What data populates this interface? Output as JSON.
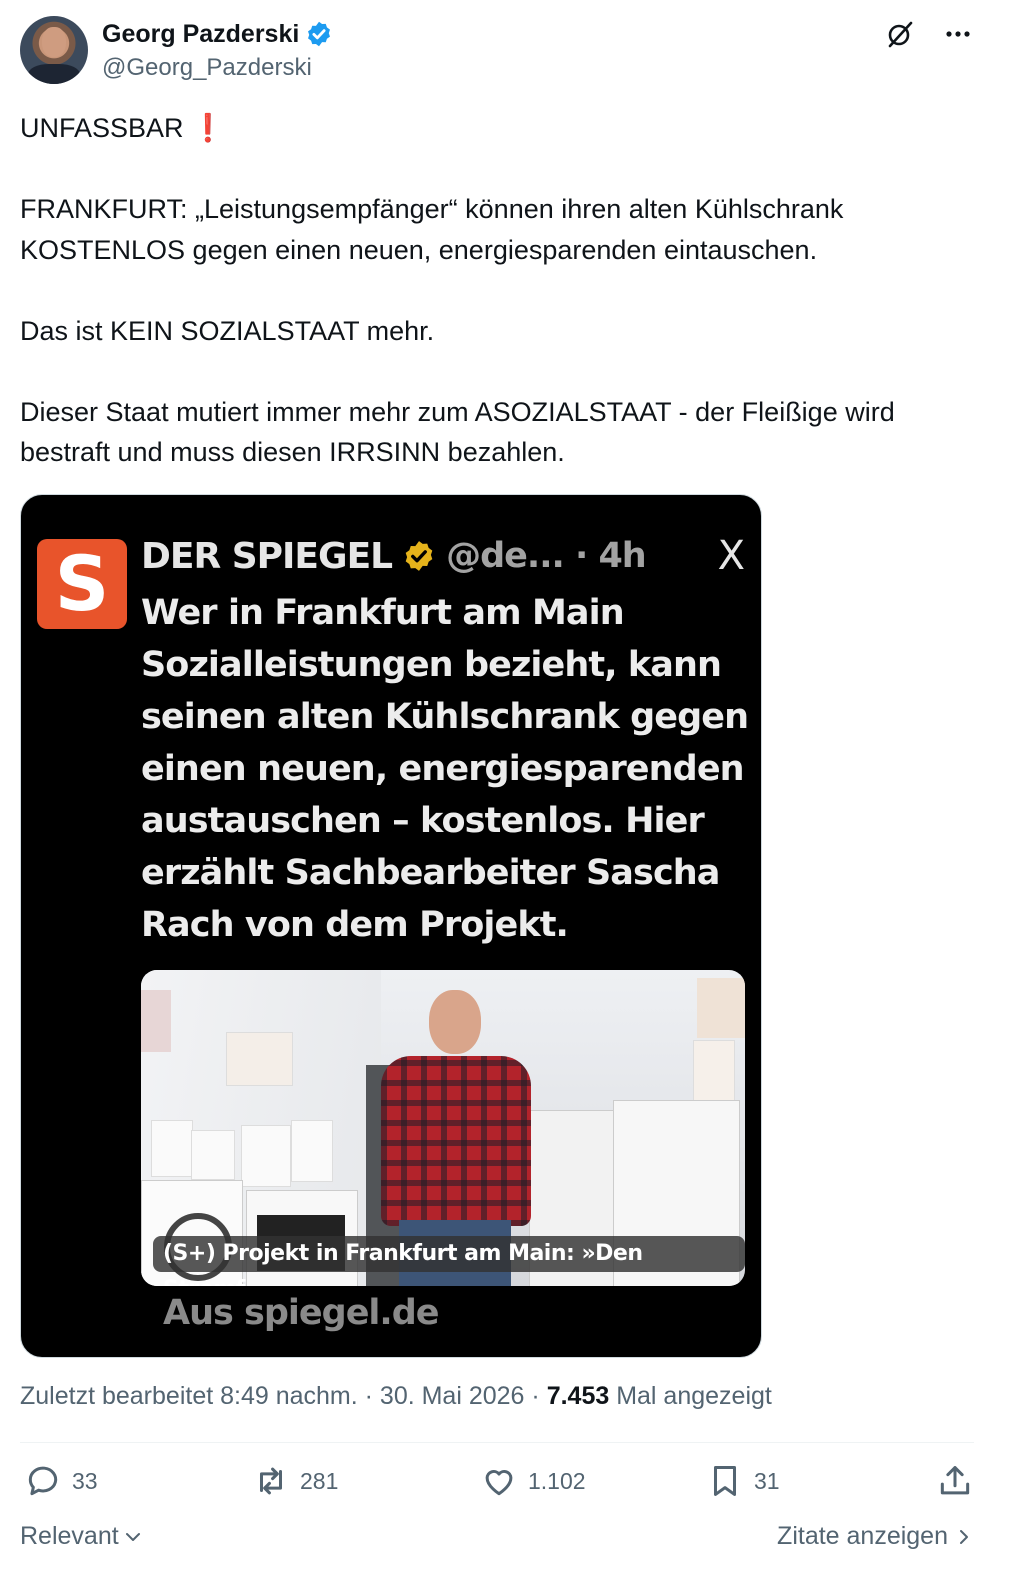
{
  "author": {
    "name": "Georg Pazderski",
    "handle": "@Georg_Pazderski",
    "verified_color": "#1d9bf0"
  },
  "tweet": {
    "text": "UNFASSBAR ❗\n\nFRANKFURT: „Leistungsempfänger“ können ihren alten Kühlschrank KOSTENLOS gegen einen neuen, energiesparenden eintauschen.\n\nDas ist KEIN SOZIALSTAAT mehr.\n\nDieser Staat mutiert immer mehr zum ASOZIALSTAAT - der Fleißige wird bestraft und muss diesen IRRSINN bezahlen."
  },
  "embedded_card": {
    "logo_letter": "S",
    "source_name": "DER SPIEGEL",
    "source_meta": "@de... · 4h",
    "x_symbol": "X",
    "body": "Wer in Frankfurt am Main Sozialleistungen bezieht, kann seinen alten Kühlschrank gegen einen neuen, energiesparenden austauschen – kostenlos. Hier erzählt Sachbearbeiter Sascha Rach von dem Projekt.",
    "photo_caption": "(S+) Projekt in Frankfurt am Main: »Den Stromf...",
    "footer": "Aus spiegel.de",
    "brand_color": "#e8542b",
    "badge_color": "#e5b31b"
  },
  "meta": {
    "edited_prefix": "Zuletzt bearbeitet 8:49 nachm. · 30. Mai 2026 · ",
    "views_count": "7.453",
    "views_label": " Mal angezeigt"
  },
  "actions": {
    "replies": "33",
    "reposts": "281",
    "likes": "1.102",
    "bookmarks": "31"
  },
  "footer": {
    "sort_label": "Relevant",
    "quotes_label": "Zitate anzeigen"
  },
  "icons": [
    "verified-badge-icon",
    "grok-icon",
    "more-icon",
    "reply-icon",
    "repost-icon",
    "like-icon",
    "bookmark-icon",
    "share-icon",
    "chevron-down-icon",
    "chevron-right-icon"
  ]
}
